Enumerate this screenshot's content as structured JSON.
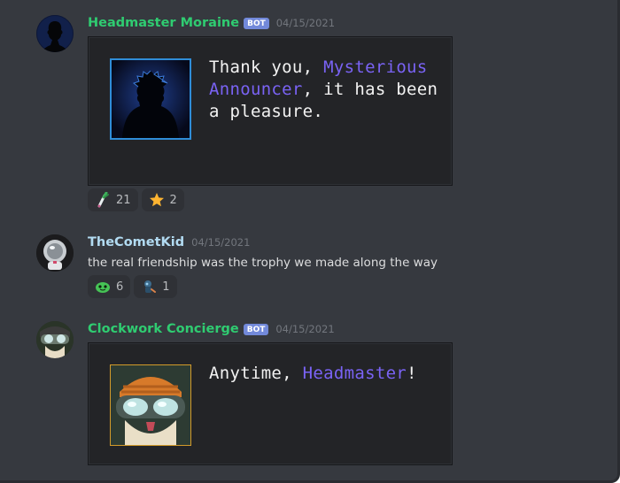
{
  "messages": [
    {
      "username": "Headmaster Moraine",
      "bot_tag": "BOT",
      "timestamp": "04/15/2021",
      "card_text": {
        "pre": "Thank you, ",
        "highlight": "Mysterious Announcer",
        "post": ", it has been a pleasure."
      },
      "reactions": [
        {
          "icon": "leek-emoji",
          "count": "21"
        },
        {
          "icon": "star-emoji",
          "count": "2"
        }
      ]
    },
    {
      "username": "TheCometKid",
      "timestamp": "04/15/2021",
      "text": "the real friendship was the trophy we made along the way",
      "reactions": [
        {
          "icon": "green-blob-emoji",
          "count": "6"
        },
        {
          "icon": "diver-emoji",
          "count": "1"
        }
      ]
    },
    {
      "username": "Clockwork Concierge",
      "bot_tag": "BOT",
      "timestamp": "04/15/2021",
      "card_text": {
        "pre": "Anytime, ",
        "highlight": "Headmaster",
        "post": "!"
      }
    }
  ],
  "colors": {
    "background": "#36393f",
    "bot_name": "#2fcc71",
    "user_name": "#b2dbf2",
    "bot_tag": "#7289da",
    "highlight": "#7a63f5"
  }
}
